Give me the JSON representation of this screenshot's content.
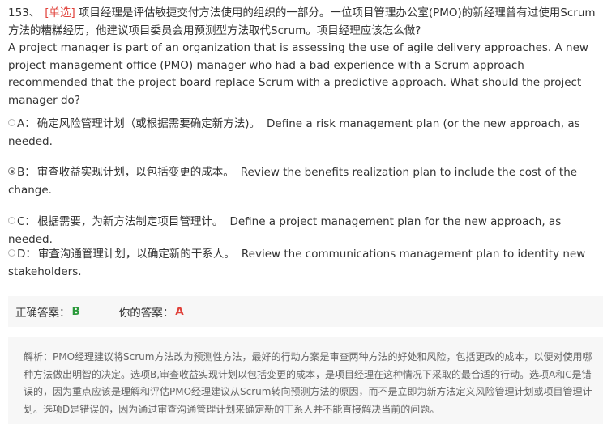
{
  "question": {
    "number": "153、",
    "type": "[单选]",
    "text_cn": "项目经理是评估敏捷交付方法使用的组织的一部分。一位项目管理办公室(PMO)的新经理曾有过使用Scrum方法的糟糕经历，他建议项目委员会用预测型方法取代Scrum。项目经理应该怎么做?",
    "text_en": "A project manager is part of an organization that is assessing the use of agile delivery approaches. A new project management office (PMO) manager who had a bad experience with a Scrum approach recommended that the project board replace Scrum with a predictive approach. What should the project manager do?"
  },
  "options": [
    {
      "key": "A：",
      "cn": "确定风险管理计划（或根据需要确定新方法)。",
      "en": "Define a risk management plan (or the new approach, as needed.",
      "selected": false
    },
    {
      "key": "B：",
      "cn": "审查收益实现计划，以包括变更的成本。",
      "en": "Review the benefits realization plan to include the cost of the change.",
      "selected": true
    },
    {
      "key": "C：",
      "cn": "根据需要，为新方法制定项目管理计。",
      "en": "Define a project management plan for the new approach, as needed.",
      "selected": false
    },
    {
      "key": "D：",
      "cn": "审查沟通管理计划，以确定新的干系人。",
      "en": "Review the communications management plan to identity new stakeholders.",
      "selected": false
    }
  ],
  "answer": {
    "correct_label": "正确答案：",
    "correct_value": "B",
    "yours_label": "你的答案：",
    "yours_value": "A"
  },
  "analysis": {
    "text": "解析：PMO经理建议将Scrum方法改为预测性方法，最好的行动方案是审查两种方法的好处和风险，包括更改的成本，以便对使用哪种方法做出明智的决定。选项B,审查收益实现计划以包括变更的成本，是项目经理在这种情况下采取的最合适的行动。选项A和C是错误的，因为重点应该是理解和评估PMO经理建议从Scrum转向预测方法的原因，而不是立即为新方法定义风险管理计划或项目管理计划。选项D是错误的，因为通过审查沟通管理计划来确定新的干系人并不能直接解决当前的问题。"
  },
  "colors": {
    "accent_red": "#e0413a",
    "correct_green": "#2b9a3b",
    "panel_bg": "#f7f7f7"
  }
}
